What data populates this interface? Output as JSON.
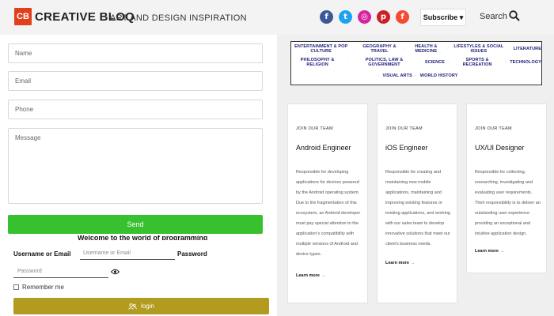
{
  "header": {
    "logo_mark": "CB",
    "logo_text": "CREATIVE BLOQ",
    "tagline": "ART AND DESIGN INSPIRATION",
    "social": [
      {
        "name": "facebook",
        "glyph": "f",
        "color": "#3b5998"
      },
      {
        "name": "twitter",
        "glyph": "t",
        "color": "#1da1f2"
      },
      {
        "name": "instagram",
        "glyph": "◎",
        "color": "#d6249f"
      },
      {
        "name": "pinterest",
        "glyph": "p",
        "color": "#cb2027"
      },
      {
        "name": "flipboard",
        "glyph": "f",
        "color": "#f74933"
      }
    ],
    "subscribe_label": "Subscribe ▾",
    "search_label": "Search"
  },
  "form": {
    "name_placeholder": "Name",
    "email_placeholder": "Email",
    "phone_placeholder": "Phone",
    "message_placeholder": "Message",
    "send_label": "Send",
    "welcome_text": "Welcome to the world of programming",
    "username_label": "Username or Email",
    "username_placeholder": "Username or Email",
    "password_label": "Password",
    "password_placeholder": "Password",
    "remember_label": "Remember me",
    "login_label": "login",
    "send_color": "#37c12f",
    "login_color": "#b39b1f"
  },
  "categories": {
    "row1": [
      "ENTERTAINMENT & POP CULTURE",
      "GEOGRAPHY & TRAVEL",
      "HEALTH & MEDICINE",
      "LIFESTYLES & SOCIAL ISSUES",
      "LITERATURE"
    ],
    "row2": [
      "PHILOSOPHY & RELIGION",
      "POLITICS, LAW & GOVERNMENT",
      "SCIENCE",
      "SPORTS & RECREATION",
      "TECHNOLOGY"
    ],
    "row3": [
      "VISUAL ARTS",
      "WORLD HISTORY"
    ]
  },
  "jobs": [
    {
      "kicker": "JOIN OUR TEAM",
      "title": "Android Engineer",
      "description": "Responsible for developing applications for devices powered by the Android operating system. Due to the fragmentation of this ecosystem, an Android developer must pay special attention to the application's compatibility with multiple versions of Android and device types.",
      "more": "Learn more"
    },
    {
      "kicker": "JOIN OUR TEAM",
      "title": "iOS Engineer",
      "description": "Responsible for creating and maintaining new mobile applications, maintaining and improving existing features or existing applications, and working with our sales team to develop innovative solutions that meet our client's business needs.",
      "more": "Learn more"
    },
    {
      "kicker": "JOIN OUR TEAM",
      "title": "UX/UI Designer",
      "description": "Responsible for collecting, researching, investigating and evaluating user requirements. Their responsibility is to deliver an outstanding user experience providing an exceptional and intuitive application design.",
      "more": "Learn more"
    }
  ]
}
